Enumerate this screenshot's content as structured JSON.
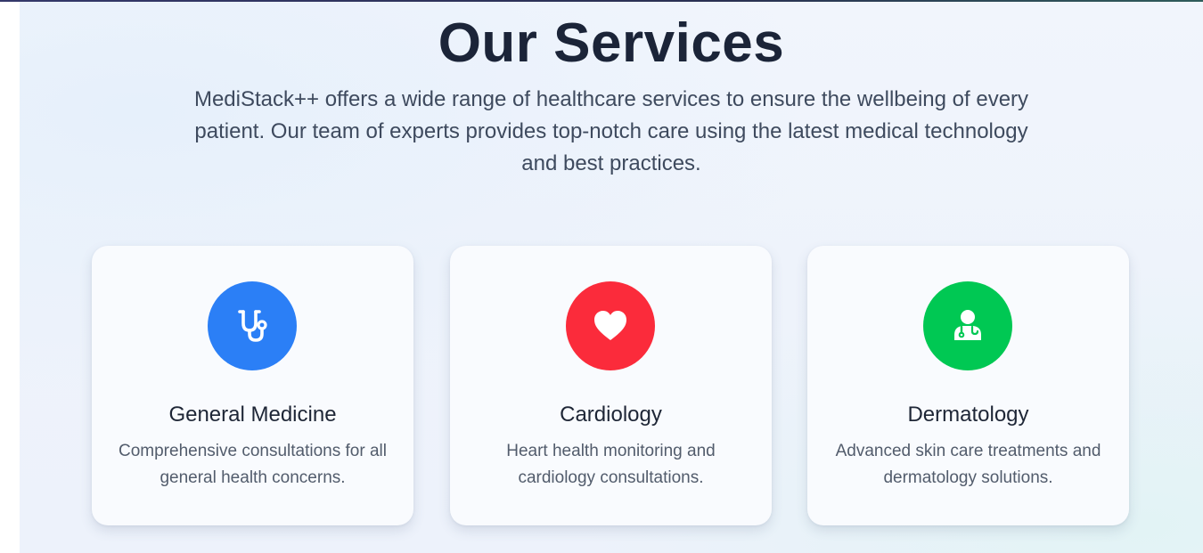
{
  "section": {
    "title": "Our Services",
    "intro": "MediStack++ offers a wide range of healthcare services to ensure the wellbeing of every patient. Our team of experts provides top-notch care using the latest medical technology and best practices."
  },
  "cards": [
    {
      "icon": "stethoscope-icon",
      "color": "#2b7ff6",
      "title": "General Medicine",
      "description": "Comprehensive consultations for all general health concerns."
    },
    {
      "icon": "heart-icon",
      "color": "#fb2b3b",
      "title": "Cardiology",
      "description": "Heart health monitoring and cardiology consultations."
    },
    {
      "icon": "doctor-icon",
      "color": "#00c853",
      "title": "Dermatology",
      "description": "Advanced skin care treatments and dermatology solutions."
    }
  ]
}
